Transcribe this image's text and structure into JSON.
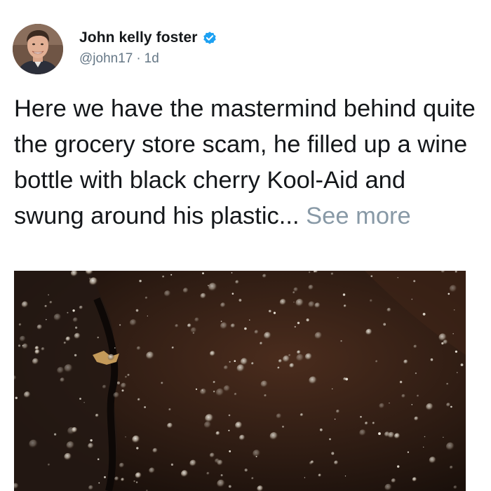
{
  "tweet": {
    "author": {
      "display_name": "John kelly foster",
      "handle": "@john17",
      "verified": true,
      "avatar_icon": "profile-photo-avatar"
    },
    "separator": "·",
    "timestamp": "1d",
    "text": "Here we have the mastermind behind quite the grocery store scam, he filled up a wine bottle with black cherry Kool-Aid and swung around his plastic... ",
    "see_more_label": "See more",
    "media": {
      "icon": "attached-photo",
      "dominant_colors": [
        "#2a1a12",
        "#3b2418",
        "#c4a27a"
      ]
    }
  },
  "colors": {
    "text": "#14171a",
    "secondary": "#657786",
    "see_more": "#8899a6",
    "verified_badge": "#1da1f2"
  }
}
